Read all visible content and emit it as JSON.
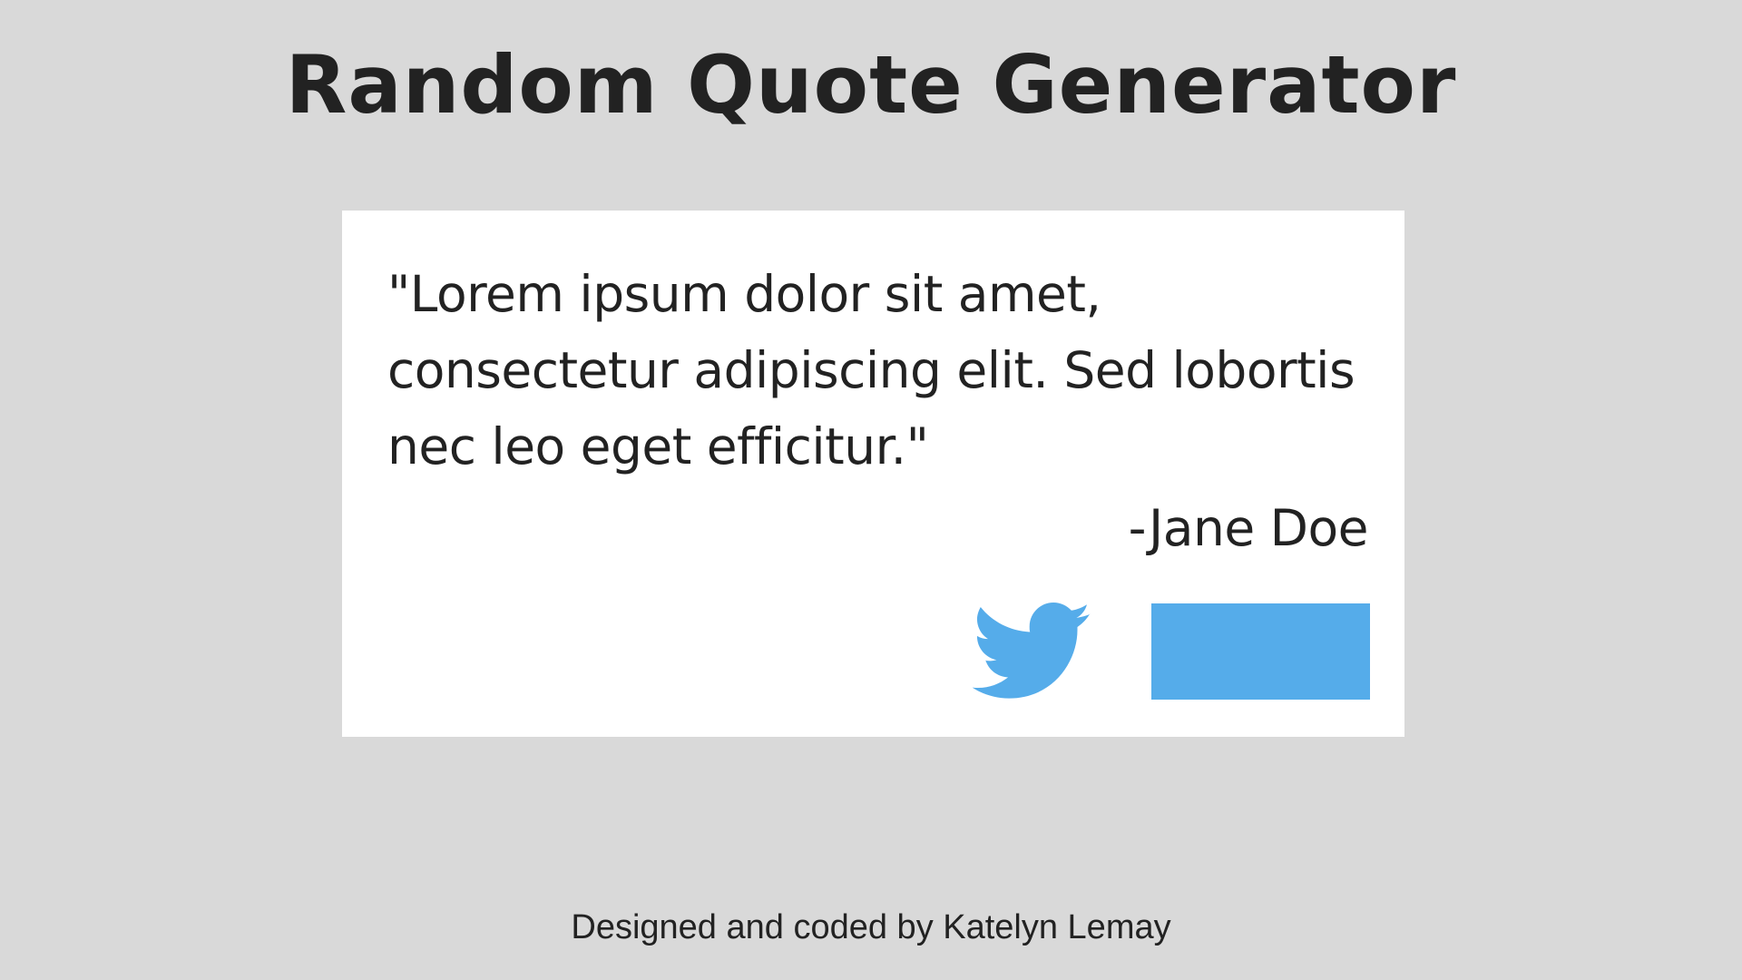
{
  "header": {
    "title": "Random Quote Generator"
  },
  "quote": {
    "text": "\"Lorem ipsum dolor sit amet, consectetur adipiscing elit. Sed lobortis nec leo eget efficitur.\"",
    "author": "-Jane Doe"
  },
  "actions": {
    "tweet_icon": "twitter-bird-icon",
    "new_quote_label": ""
  },
  "footer": {
    "credit": "Designed and coded by Katelyn Lemay"
  },
  "colors": {
    "background": "#d9d9d9",
    "card": "#ffffff",
    "accent": "#55acea",
    "text": "#222222"
  }
}
